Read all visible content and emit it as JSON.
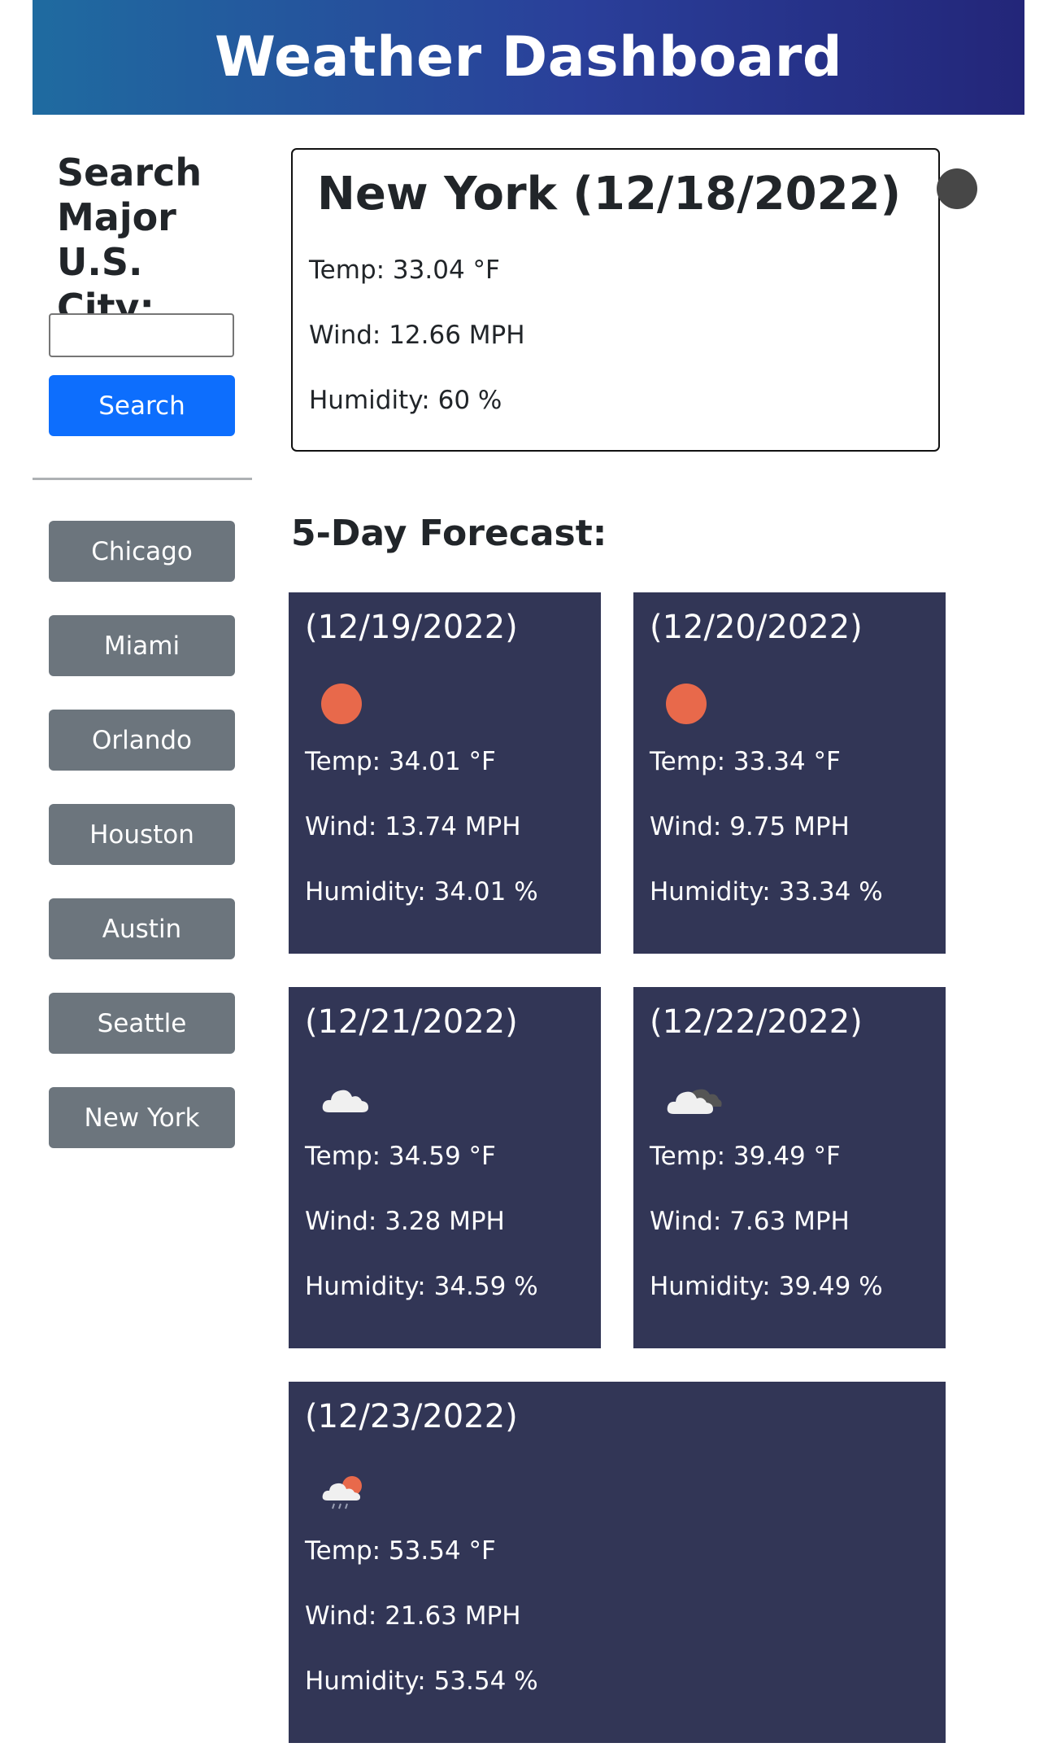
{
  "header": {
    "title": "Weather Dashboard"
  },
  "sidebar": {
    "search_title": "Search Major U.S. City:",
    "search_input_value": "",
    "search_button": "Search",
    "cities": [
      "Chicago",
      "Miami",
      "Orlando",
      "Houston",
      "Austin",
      "Seattle",
      "New York"
    ]
  },
  "current": {
    "title": "New York (12/18/2022)",
    "icon": "moon-icon",
    "temp": "Temp: 33.04 °F",
    "wind": "Wind: 12.66 MPH",
    "humidity": "Humidity: 60 %"
  },
  "forecast": {
    "title": "5-Day Forecast:",
    "days": [
      {
        "date": "(12/19/2022)",
        "icon": "sun-icon",
        "temp": "Temp: 34.01 °F",
        "wind": "Wind: 13.74 MPH",
        "humidity": "Humidity: 34.01 %"
      },
      {
        "date": "(12/20/2022)",
        "icon": "sun-icon",
        "temp": "Temp: 33.34 °F",
        "wind": "Wind: 9.75 MPH",
        "humidity": "Humidity: 33.34 %"
      },
      {
        "date": "(12/21/2022)",
        "icon": "cloud-icon",
        "temp": "Temp: 34.59 °F",
        "wind": "Wind: 3.28 MPH",
        "humidity": "Humidity: 34.59 %"
      },
      {
        "date": "(12/22/2022)",
        "icon": "broken-clouds-icon",
        "temp": "Temp: 39.49 °F",
        "wind": "Wind: 7.63 MPH",
        "humidity": "Humidity: 39.49 %"
      },
      {
        "date": "(12/23/2022)",
        "icon": "rain-sun-icon",
        "temp": "Temp: 53.54 °F",
        "wind": "Wind: 21.63 MPH",
        "humidity": "Humidity: 53.54 %"
      }
    ]
  },
  "colors": {
    "header_gradient_start": "#1f6ba0",
    "header_gradient_end": "#232679",
    "search_button": "#0d6efd",
    "city_button": "#6c757d",
    "forecast_card": "#323656",
    "sun": "#e8694b",
    "moon": "#474747"
  }
}
